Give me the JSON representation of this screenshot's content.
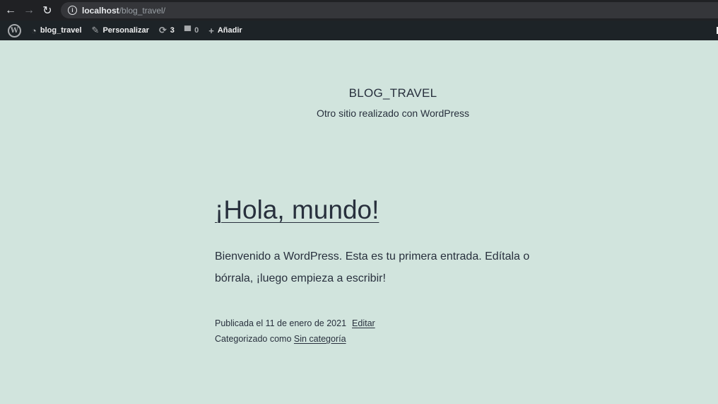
{
  "browser": {
    "back_icon": "arrow-left-icon",
    "forward_icon": "arrow-right-icon",
    "reload_icon": "reload-icon",
    "url_host": "localhost",
    "url_path": "/blog_travel/"
  },
  "adminbar": {
    "site_name": "blog_travel",
    "customize": "Personalizar",
    "updates_count": "3",
    "comments_count": "0",
    "new_label": "Añadir"
  },
  "site": {
    "title": "BLOG_TRAVEL",
    "description": "Otro sitio realizado con WordPress"
  },
  "post": {
    "title": "¡Hola, mundo!",
    "content": "Bienvenido a WordPress. Esta es tu primera entrada. Edítala o bórrala, ¡luego empieza a escribir!",
    "published": "Publicada el 11 de enero de 2021",
    "edit_link": "Editar",
    "categorized": "Categorizado como",
    "category_link": "Sin categoría"
  },
  "colors": {
    "page_bg": "#d1e4dd",
    "text": "#28303d",
    "adminbar_bg": "#1d2327",
    "browser_bg": "#202124"
  }
}
